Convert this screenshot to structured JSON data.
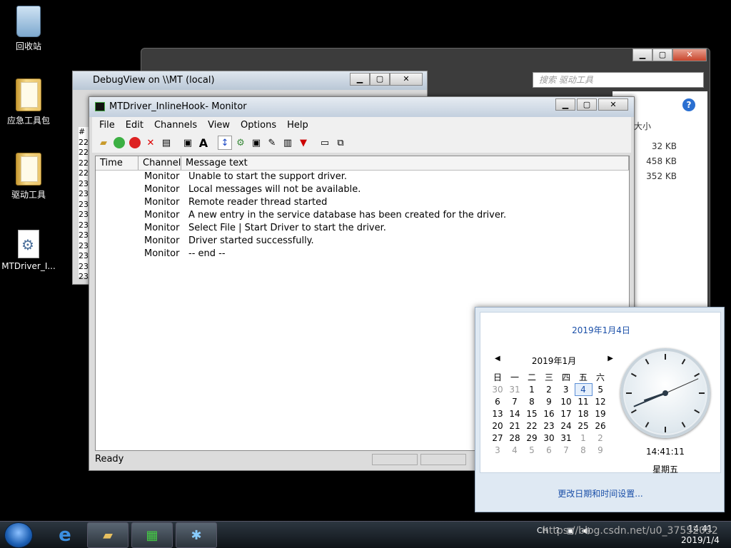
{
  "desktop": {
    "icons": [
      {
        "label": "回收站"
      },
      {
        "label": "应急工具包"
      },
      {
        "label": "驱动工具"
      },
      {
        "label": "MTDriver_I..."
      }
    ]
  },
  "explorer": {
    "search_placeholder": "搜索 驱动工具",
    "col_size": "大小",
    "sizes": [
      "32 KB",
      "458 KB",
      "352 KB"
    ],
    "help": "?"
  },
  "debugview": {
    "title": "DebugView on \\\\MT (local)",
    "side_rows": [
      "#",
      "22",
      "22",
      "22",
      "22",
      "23",
      "23",
      "23",
      "23",
      "23",
      "23",
      "23",
      "23",
      "23",
      "23"
    ]
  },
  "monitor": {
    "title": "MTDriver_InlineHook- Monitor",
    "menu": [
      "File",
      "Edit",
      "Channels",
      "View",
      "Options",
      "Help"
    ],
    "columns": [
      "Time",
      "Channel",
      "Message text"
    ],
    "rows": [
      {
        "time": "",
        "channel": "Monitor",
        "message": "Unable to start the support driver."
      },
      {
        "time": "",
        "channel": "Monitor",
        "message": "Local messages will not be available."
      },
      {
        "time": "",
        "channel": "Monitor",
        "message": "Remote reader thread started"
      },
      {
        "time": "",
        "channel": "Monitor",
        "message": "A new entry in the service database has been created for the driver."
      },
      {
        "time": "",
        "channel": "Monitor",
        "message": "Select File | Start Driver to start the driver."
      },
      {
        "time": "",
        "channel": "Monitor",
        "message": "Driver started successfully."
      },
      {
        "time": "",
        "channel": "Monitor",
        "message": " -- end --"
      }
    ],
    "status": "Ready"
  },
  "calendar": {
    "date_header": "2019年1月4日",
    "month_label": "2019年1月",
    "weekdays": [
      "日",
      "一",
      "二",
      "三",
      "四",
      "五",
      "六"
    ],
    "weeks": [
      [
        "30",
        "31",
        "1",
        "2",
        "3",
        "4",
        "5"
      ],
      [
        "6",
        "7",
        "8",
        "9",
        "10",
        "11",
        "12"
      ],
      [
        "13",
        "14",
        "15",
        "16",
        "17",
        "18",
        "19"
      ],
      [
        "20",
        "21",
        "22",
        "23",
        "24",
        "25",
        "26"
      ],
      [
        "27",
        "28",
        "29",
        "30",
        "31",
        "1",
        "2"
      ],
      [
        "3",
        "4",
        "5",
        "6",
        "7",
        "8",
        "9"
      ]
    ],
    "time": "14:41:11",
    "weekday": "星期五",
    "settings_link": "更改日期和时间设置..."
  },
  "taskbar": {
    "lang": "CH",
    "clock_time": "14:41",
    "clock_date": "2019/1/4"
  },
  "watermark": "https://blog.csdn.net/u0_37552052"
}
